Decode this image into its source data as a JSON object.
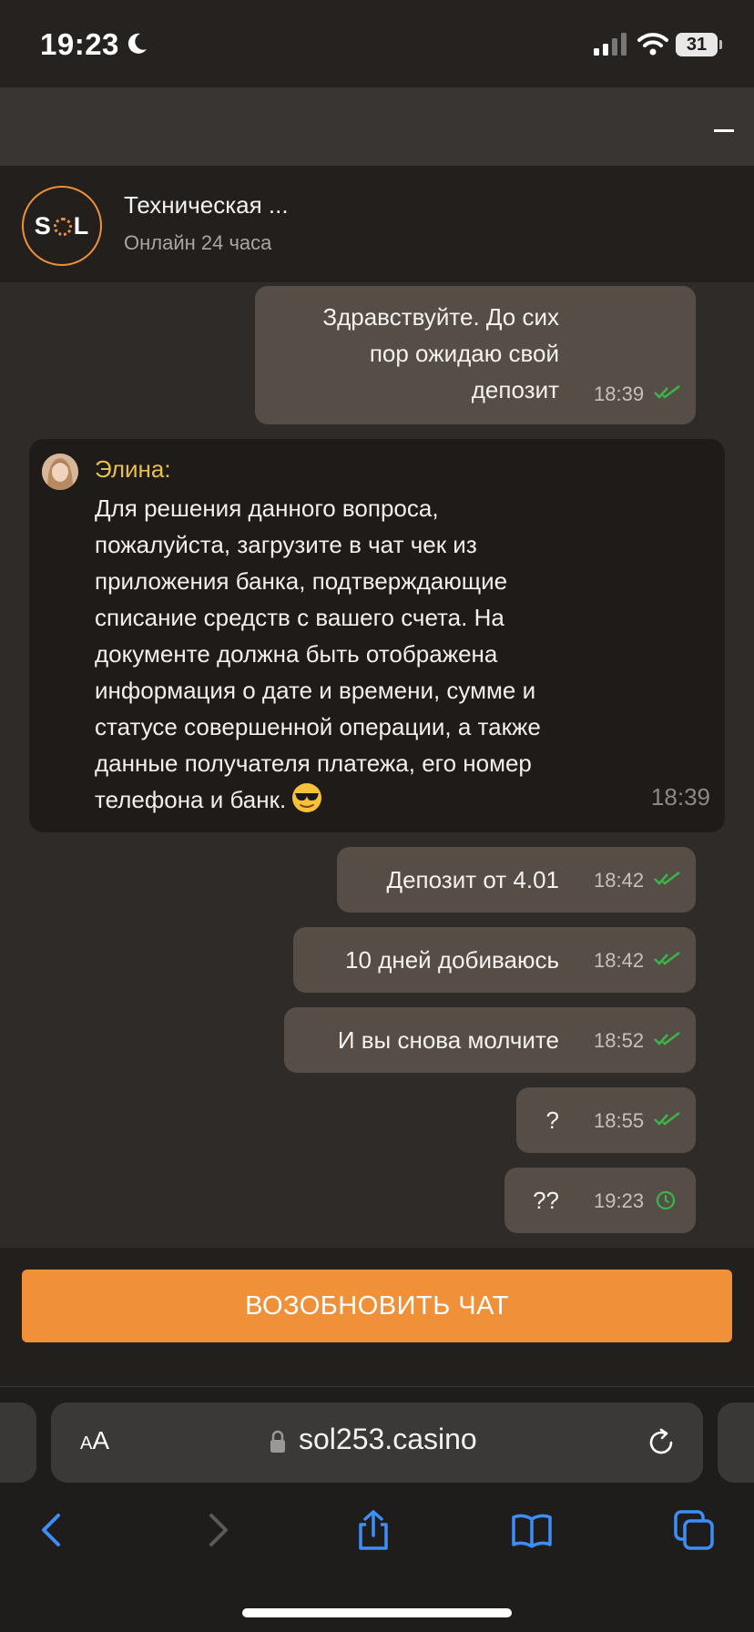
{
  "status_bar": {
    "time": "19:23",
    "battery": "31"
  },
  "header": {
    "logo_text_left": "S",
    "logo_text_right": "L",
    "title": "Техническая ...",
    "subtitle": "Онлайн 24 часа"
  },
  "messages": {
    "m1": {
      "lines": [
        "Здравствуйте. До сих",
        "пор ожидаю свой",
        "депозит"
      ],
      "time": "18:39"
    },
    "agent": {
      "name": "Элина:",
      "lines": [
        "Для решения данного вопроса,",
        "пожалуйста, загрузите в чат чек из",
        "приложения банка, подтверждающие",
        "списание средств с вашего счета. На",
        "документе должна быть отображена",
        "информация о дате и времени, сумме и",
        "статусе совершенной операции, а также",
        "данные получателя платежа, его номер",
        "телефона и банк."
      ],
      "emoji": "smiling-face-with-sunglasses",
      "time": "18:39"
    },
    "m2": {
      "text": "Депозит от 4.01",
      "time": "18:42"
    },
    "m3": {
      "text": "10 дней добиваюсь",
      "time": "18:42"
    },
    "m4": {
      "text": "И вы снова молчите",
      "time": "18:52"
    },
    "m5": {
      "text": "?",
      "time": "18:55"
    },
    "m6": {
      "text": "??",
      "time": "19:23",
      "status": "pending"
    }
  },
  "resume_button": "ВОЗОБНОВИТЬ ЧАТ",
  "browser": {
    "aa_small": "A",
    "aa_big": "A",
    "url": "sol253.casino"
  },
  "colors": {
    "accent": "#f0913a",
    "agent_name": "#e8bf4a",
    "read_tick": "#39b54a",
    "out_bubble": "#564d46",
    "in_bubble": "#1f1b19"
  }
}
